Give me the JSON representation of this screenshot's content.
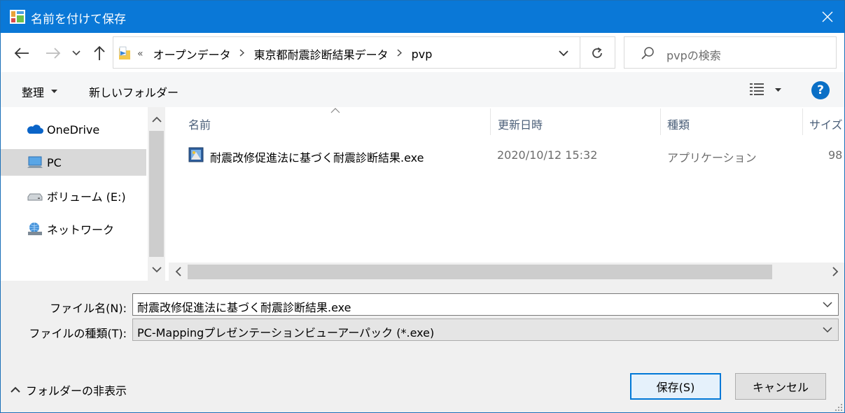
{
  "window": {
    "title": "名前を付けて保存",
    "accent": "#0a78d7"
  },
  "address": {
    "overflow": "«",
    "crumbs": [
      "オープンデータ",
      "東京都耐震診断結果データ",
      "pvp"
    ]
  },
  "search": {
    "placeholder": "pvpの検索"
  },
  "toolbar": {
    "organize": "整理",
    "new_folder": "新しいフォルダー"
  },
  "navpane": {
    "items": [
      {
        "label": "OneDrive",
        "icon": "cloud-icon",
        "selected": false
      },
      {
        "label": "PC",
        "icon": "computer-icon",
        "selected": true
      },
      {
        "label": "ボリューム (E:)",
        "icon": "drive-icon",
        "selected": false
      },
      {
        "label": "ネットワーク",
        "icon": "network-icon",
        "selected": false
      }
    ]
  },
  "filelist": {
    "columns": [
      "名前",
      "更新日時",
      "種類",
      "サイズ"
    ],
    "rows": [
      {
        "name": "耐震改修促進法に基づく耐震診断結果.exe",
        "modified": "2020/10/12 15:32",
        "type": "アプリケーション",
        "size": "98"
      }
    ]
  },
  "form": {
    "filename_label": "ファイル名(N):",
    "filename_value": "耐震改修促進法に基づく耐震診断結果.exe",
    "filetype_label": "ファイルの種類(T):",
    "filetype_value": "PC-Mappingプレゼンテーションビューアーパック (*.exe)"
  },
  "footer": {
    "hide_folders": "フォルダーの非表示",
    "save": "保存(S)",
    "cancel": "キャンセル"
  }
}
